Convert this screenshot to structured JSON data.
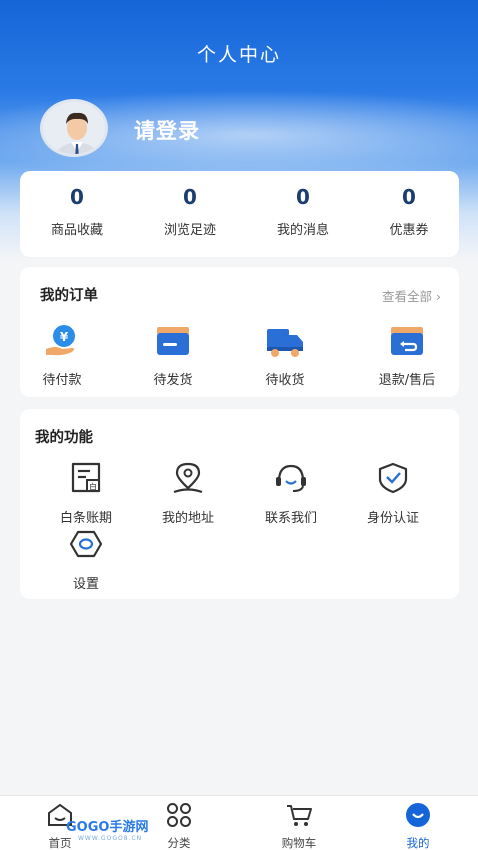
{
  "header": {
    "title": "个人中心",
    "login_text": "请登录"
  },
  "stats": [
    {
      "value": "0",
      "label": "商品收藏"
    },
    {
      "value": "0",
      "label": "浏览足迹"
    },
    {
      "value": "0",
      "label": "我的消息"
    },
    {
      "value": "0",
      "label": "优惠券"
    }
  ],
  "orders": {
    "title": "我的订单",
    "view_all": "查看全部 ›",
    "items": [
      {
        "label": "待付款",
        "icon": "payment-icon"
      },
      {
        "label": "待发货",
        "icon": "pending-shipment-icon"
      },
      {
        "label": "待收货",
        "icon": "truck-icon"
      },
      {
        "label": "退款/售后",
        "icon": "refund-icon"
      }
    ]
  },
  "functions": {
    "title": "我的功能",
    "items": [
      {
        "label": "白条账期",
        "icon": "credit-icon"
      },
      {
        "label": "我的地址",
        "icon": "location-icon"
      },
      {
        "label": "联系我们",
        "icon": "headset-icon"
      },
      {
        "label": "身份认证",
        "icon": "shield-icon"
      },
      {
        "label": "设置",
        "icon": "settings-icon"
      }
    ]
  },
  "tabbar": [
    {
      "label": "首页",
      "icon": "home-icon"
    },
    {
      "label": "分类",
      "icon": "grid-icon"
    },
    {
      "label": "购物车",
      "icon": "cart-icon"
    },
    {
      "label": "我的",
      "icon": "profile-icon",
      "active": true
    }
  ],
  "watermark": {
    "text": "GOGO手游网",
    "sub": "WWW.GOGO8.CN"
  },
  "colors": {
    "accent": "#1565d8",
    "number": "#1a3e6e",
    "background": "#f4f5f7"
  }
}
